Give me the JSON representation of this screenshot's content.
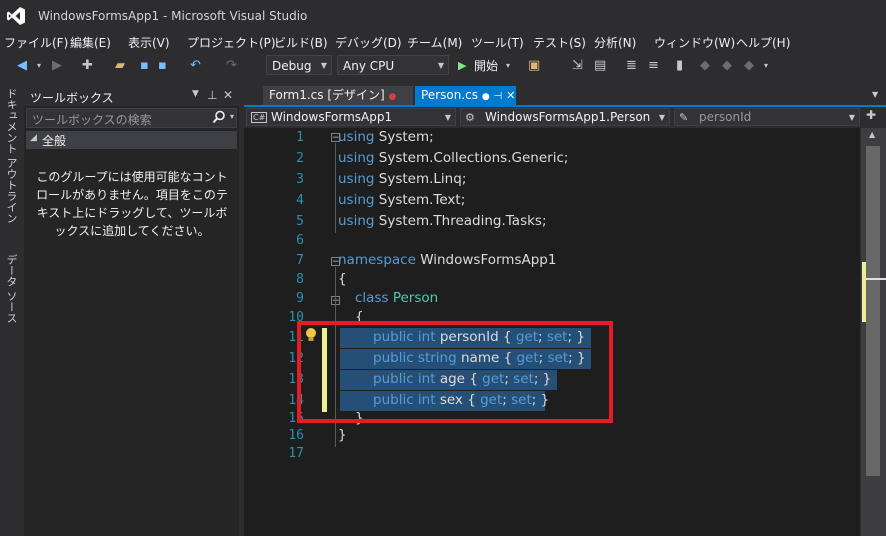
{
  "window": {
    "title": "WindowsFormsApp1 - Microsoft Visual Studio"
  },
  "menu": [
    "ファイル(F)",
    "編集(E)",
    "表示(V)",
    "プロジェクト(P)",
    "ビルド(B)",
    "デバッグ(D)",
    "チーム(M)",
    "ツール(T)",
    "テスト(S)",
    "分析(N)",
    "ウィンドウ(W)",
    "ヘルプ(H)"
  ],
  "toolbar": {
    "config": "Debug",
    "platform": "Any CPU",
    "start_label": "開始"
  },
  "sidetabs": [
    "ドキュメント アウトライン",
    "データ ソース"
  ],
  "toolbox": {
    "title": "ツールボックス",
    "search_placeholder": "ツールボックスの検索",
    "group": "全般",
    "empty_text": "このグループには使用可能なコントロールがありません。項目をこのテキスト上にドラッグして、ツールボックスに追加してください。"
  },
  "tabs": [
    {
      "label": "Form1.cs [デザイン]",
      "active": false
    },
    {
      "label": "Person.cs",
      "active": true
    }
  ],
  "nav": {
    "project": "WindowsFormsApp1",
    "type": "WindowsFormsApp1.Person",
    "member": "personId"
  },
  "code": {
    "line_numbers": [
      "1",
      "2",
      "3",
      "4",
      "5",
      "6",
      "7",
      "8",
      "9",
      "10",
      "11",
      "12",
      "13",
      "14",
      "15",
      "16",
      "17"
    ],
    "lines": [
      "using System;",
      "using System.Collections.Generic;",
      "using System.Linq;",
      "using System.Text;",
      "using System.Threading.Tasks;",
      "",
      "namespace WindowsFormsApp1",
      "{",
      "class Person",
      "{",
      "public int personId { get; set; }",
      "public string name { get; set; }",
      "public int age { get; set; }",
      "public int sex { get; set; }",
      "}",
      "}",
      ""
    ]
  },
  "colors": {
    "accent": "#007acc",
    "highlight_box": "#e51c23",
    "selection": "#264f78",
    "keyword": "#569cd6",
    "type": "#4ec9b0"
  }
}
